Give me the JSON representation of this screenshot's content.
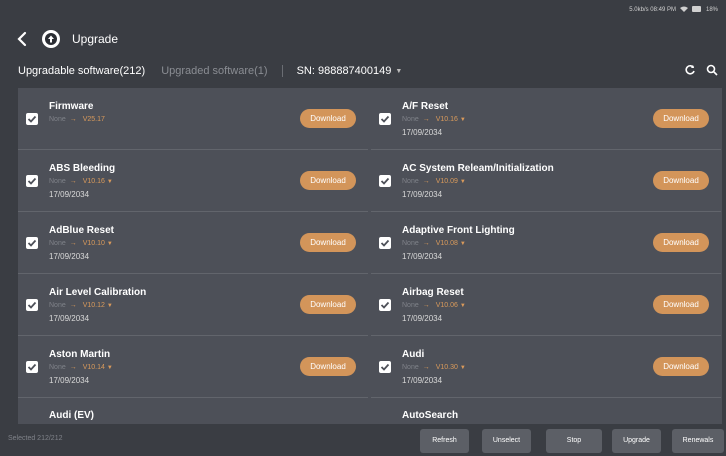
{
  "status": {
    "text": "5.0kb/s 08:49 PM",
    "battery": "18%"
  },
  "titlebar": {
    "title": "Upgrade"
  },
  "tabs": {
    "upgradable": "Upgradable software(212)",
    "upgraded": "Upgraded software(1)",
    "sn": "SN: 988887400149"
  },
  "download_label": "Download",
  "left": [
    {
      "name": "Firmware",
      "from": "None",
      "to": "V25.17",
      "date": "",
      "dropdown": false
    },
    {
      "name": "ABS Bleeding",
      "from": "None",
      "to": "V10.16",
      "date": "17/09/2034",
      "dropdown": true
    },
    {
      "name": "AdBlue Reset",
      "from": "None",
      "to": "V10.10",
      "date": "17/09/2034",
      "dropdown": true
    },
    {
      "name": "Air Level Calibration",
      "from": "None",
      "to": "V10.12",
      "date": "17/09/2034",
      "dropdown": true
    },
    {
      "name": "Aston Martin",
      "from": "None",
      "to": "V10.14",
      "date": "17/09/2034",
      "dropdown": true
    },
    {
      "name": "Audi (EV)",
      "from": "",
      "to": "",
      "date": "",
      "dropdown": false
    }
  ],
  "right": [
    {
      "name": "A/F Reset",
      "from": "None",
      "to": "V10.16",
      "date": "17/09/2034",
      "dropdown": true
    },
    {
      "name": "AC System Releam/Initialization",
      "from": "None",
      "to": "V10.09",
      "date": "17/09/2034",
      "dropdown": true
    },
    {
      "name": "Adaptive Front Lighting",
      "from": "None",
      "to": "V10.08",
      "date": "17/09/2034",
      "dropdown": true
    },
    {
      "name": "Airbag Reset",
      "from": "None",
      "to": "V10.06",
      "date": "17/09/2034",
      "dropdown": true
    },
    {
      "name": "Audi",
      "from": "None",
      "to": "V10.30",
      "date": "17/09/2034",
      "dropdown": true
    },
    {
      "name": "AutoSearch",
      "from": "",
      "to": "",
      "date": "",
      "dropdown": false
    }
  ],
  "bottom": {
    "selected": "Selected 212/212",
    "buttons": [
      "Refresh",
      "Unselect",
      "Stop",
      "Upgrade",
      "Renewals"
    ]
  },
  "colors": {
    "accent": "#d3955a",
    "panel": "#4d5058",
    "background": "#3a3d43"
  }
}
